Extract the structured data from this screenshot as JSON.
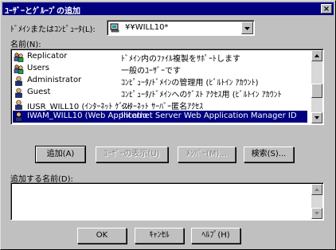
{
  "window": {
    "title": "ﾕｰｻﾞｰとｸﾞﾙｰﾌﾟの追加",
    "close": "×"
  },
  "domain_label": "ﾄﾞﾒｲﾝまたはｺﾝﾋﾟｭｰﾀ(L):",
  "domain_value": "¥¥WILL10*",
  "names_label": "名前(N):",
  "list": [
    {
      "name": "Replicator",
      "desc": "ﾄﾞﾒｲﾝ内のﾌｧｲﾙ複製をｻﾎﾟｰﾄします",
      "icon": "group-icon"
    },
    {
      "name": "Users",
      "desc": "一般のﾕｰｻﾞｰです",
      "icon": "group-icon"
    },
    {
      "name": "Administrator",
      "desc": "ｺﾝﾋﾟｭｰﾀ/ﾄﾞﾒｲﾝの管理用 (ﾋﾞﾙﾄｲﾝ ｱｶｳﾝﾄ)",
      "icon": "user-icon"
    },
    {
      "name": "Guest",
      "desc": "ｺﾝﾋﾟｭｰﾀ/ﾄﾞﾒｲﾝへのｹﾞｽﾄ ｱｸｾｽ用 (ﾋﾞﾙﾄｲﾝ ｱｶｳﾝﾄ",
      "icon": "user-icon"
    },
    {
      "name": "IUSR_WILL10 (ｲﾝﾀｰﾈｯﾄ ｹﾞｽﾄ",
      "desc": "ｲﾝﾀｰﾈｯﾄ ｻｰﾊﾞｰ匿名ｱｸｾｽ",
      "icon": "user-icon"
    },
    {
      "name": "IWAM_WILL10 (Web Applicatio",
      "desc": "Internet Server Web Application Manager ID",
      "icon": "user-icon",
      "selected": true
    }
  ],
  "buttons": {
    "add": "追加(A)",
    "show_users": "ﾕｰｻﾞｰの表示(U)",
    "members": "ﾒﾝﾊﾞｰ(M)...",
    "search": "検索(S)...",
    "ok": "OK",
    "cancel": "ｷｬﾝｾﾙ",
    "help": "ﾍﾙﾌﾟ(H)"
  },
  "add_names_label": "追加する名前(D):",
  "add_names_value": ""
}
